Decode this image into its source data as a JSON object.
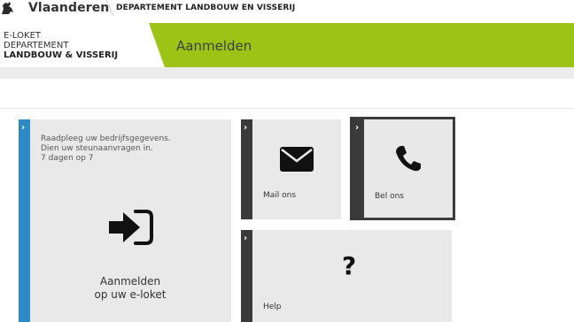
{
  "topbar": {
    "brand": "Vlaanderen",
    "department": "DEPARTEMENT LANDBOUW EN VISSERIJ"
  },
  "header": {
    "logo_line1": "E-LOKET",
    "logo_line2": "DEPARTEMENT",
    "logo_line3": "LANDBOUW & VISSERIJ",
    "title": "Aanmelden"
  },
  "tiles": {
    "login": {
      "description_lines": [
        "Raadpleeg uw bedrijfsgegevens.",
        "Dien uw steunaanvragen in.",
        "7 dagen op 7"
      ],
      "label_line1": "Aanmelden",
      "label_line2": "op uw e-loket",
      "icon": "sign-in-icon"
    },
    "mail": {
      "label": "Mail ons",
      "icon": "envelope-icon"
    },
    "bel": {
      "label": "Bel ons",
      "icon": "phone-icon"
    },
    "help": {
      "label": "Help",
      "icon": "question-icon",
      "icon_glyph": "?"
    },
    "chevron": "›"
  },
  "colors": {
    "accent_green": "#9bc417",
    "accent_blue": "#2e8ac4",
    "stripe_dark": "#3a3a3a",
    "tile_bg": "#e9e9e9"
  }
}
